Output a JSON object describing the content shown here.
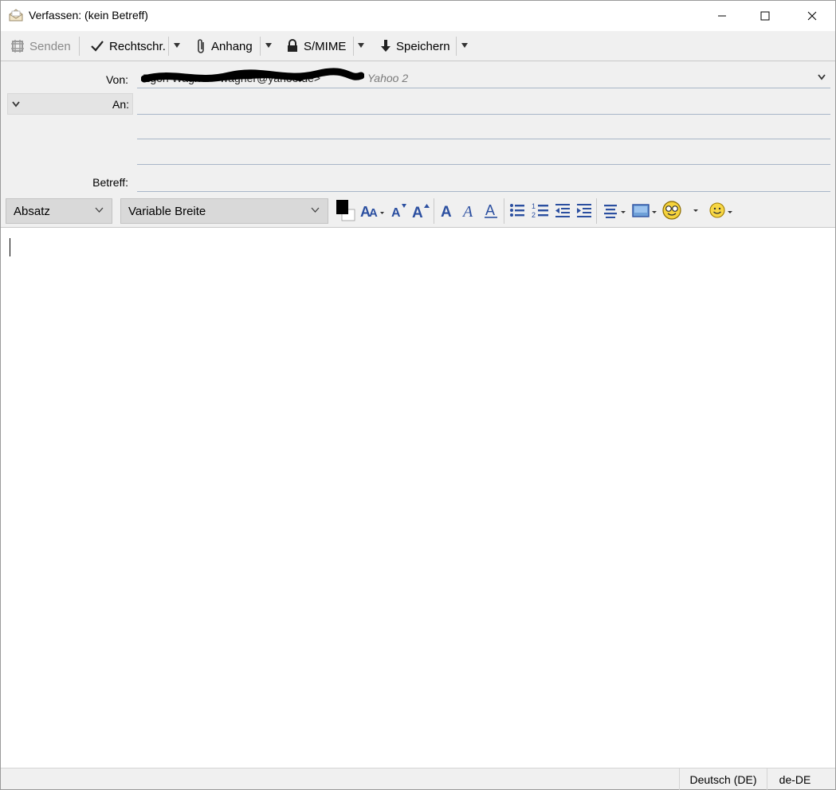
{
  "window": {
    "title": "Verfassen: (kein Betreff)"
  },
  "toolbar": {
    "send_label": "Senden",
    "spell_label": "Rechtschr.",
    "attach_label": "Anhang",
    "smime_label": "S/MIME",
    "save_label": "Speichern"
  },
  "header": {
    "from_label": "Von:",
    "from_value": "Egon Wagner <wagner@yahoo.de>",
    "from_account": "Yahoo 2",
    "to_label": "An:",
    "subject_label": "Betreff:",
    "to_value": "",
    "subject_value": ""
  },
  "format": {
    "paragraph_select": "Absatz",
    "font_select": "Variable Breite"
  },
  "status": {
    "language": "Deutsch (DE)",
    "locale": "de-DE"
  },
  "colors": {
    "accent_blue": "#2b4fa0",
    "chrome_bg": "#f0f0f0",
    "field_line": "#a8b6c8"
  }
}
